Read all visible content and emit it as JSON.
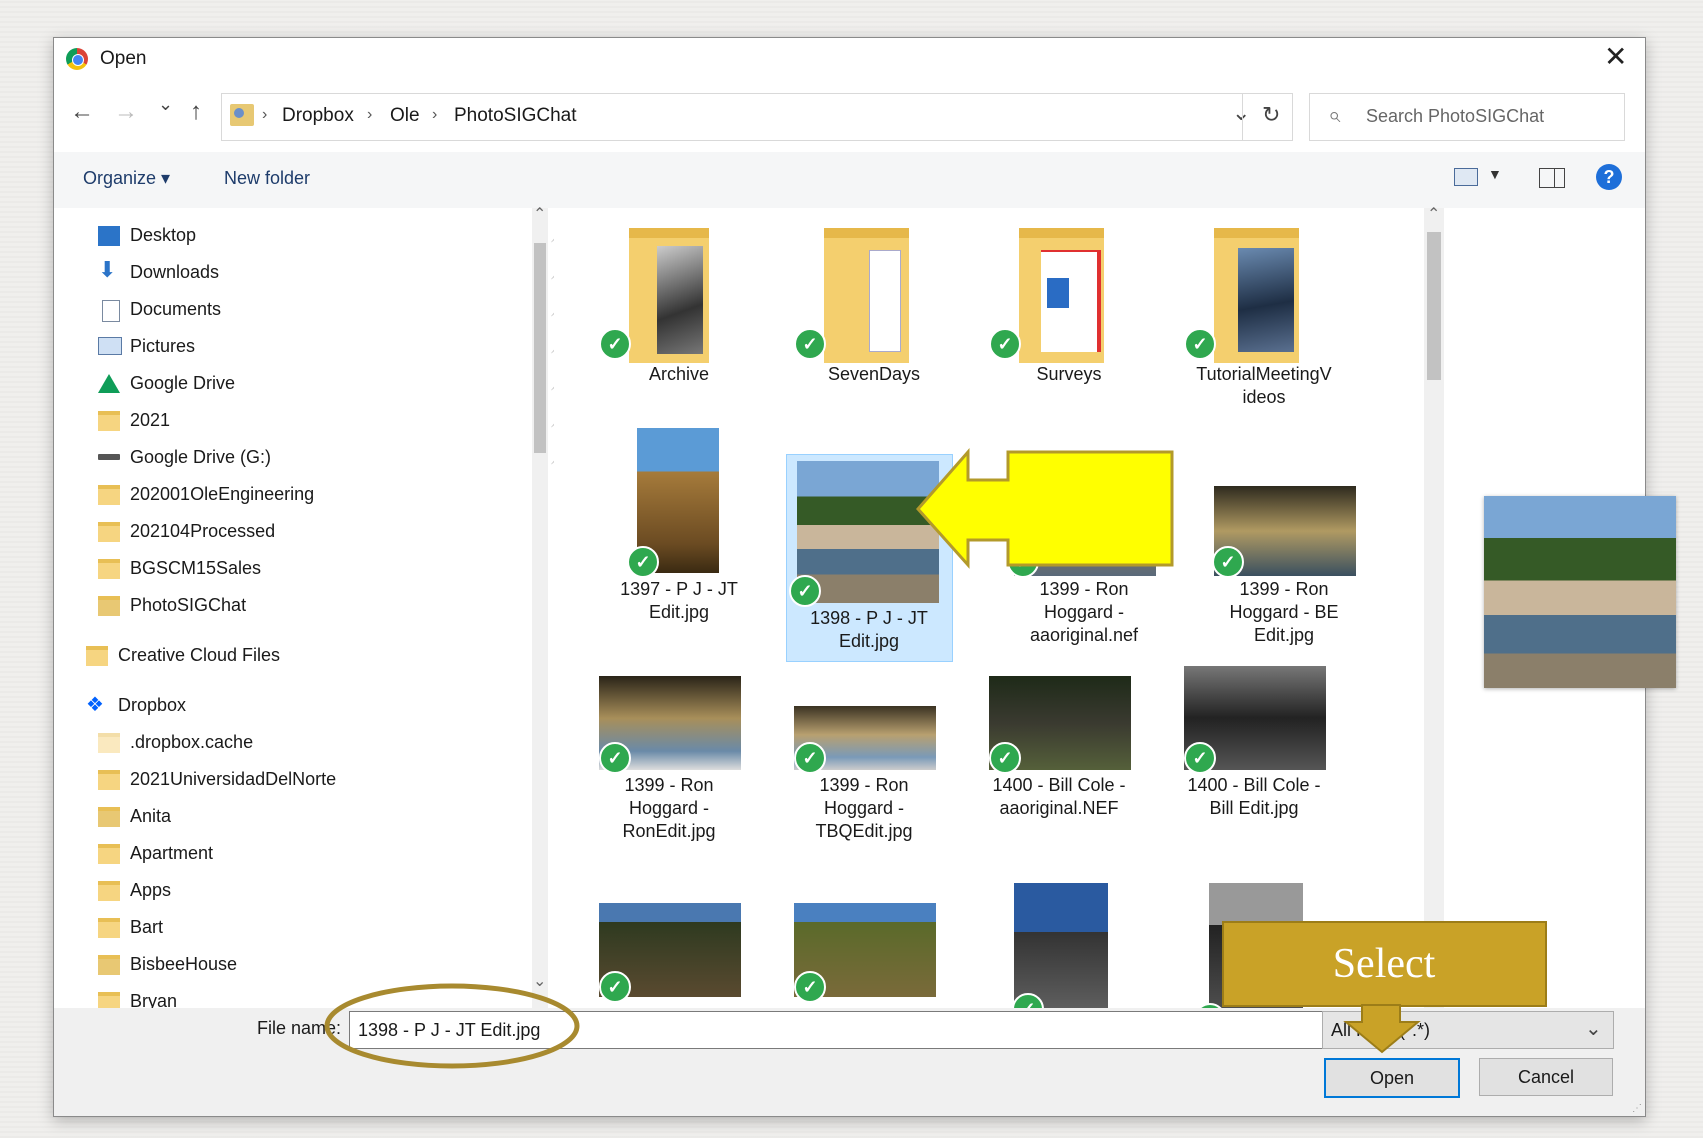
{
  "dialog": {
    "title": "Open",
    "close_glyph": "✕"
  },
  "nav": {
    "back": "←",
    "forward": "→",
    "recent": "⌄",
    "up": "↑",
    "dropdown": "⌄",
    "refresh": "↻"
  },
  "address": {
    "crumbs": [
      "Dropbox",
      "Ole",
      "PhotoSIGChat"
    ],
    "sep": "›"
  },
  "search": {
    "placeholder": "Search PhotoSIGChat",
    "icon": "⌕"
  },
  "toolbar": {
    "organize": "Organize ▾",
    "new_folder": "New folder",
    "help": "?"
  },
  "sidebar": {
    "items": [
      {
        "label": "Desktop"
      },
      {
        "label": "Downloads"
      },
      {
        "label": "Documents"
      },
      {
        "label": "Pictures"
      },
      {
        "label": "Google Drive"
      },
      {
        "label": "2021"
      },
      {
        "label": "Google Drive (G:)"
      },
      {
        "label": "202001OleEngineering"
      },
      {
        "label": "202104Processed"
      },
      {
        "label": "BGSCM15Sales"
      },
      {
        "label": "PhotoSIGChat"
      },
      {
        "label": "Creative Cloud Files"
      },
      {
        "label": "Dropbox"
      },
      {
        "label": ".dropbox.cache"
      },
      {
        "label": "2021UniversidadDelNorte"
      },
      {
        "label": "Anita"
      },
      {
        "label": "Apartment"
      },
      {
        "label": "Apps"
      },
      {
        "label": "Bart"
      },
      {
        "label": "BisbeeHouse"
      },
      {
        "label": "Bryan"
      }
    ],
    "pin_glyph": "📌"
  },
  "files": {
    "row1": [
      "Archive",
      "SevenDays",
      "Surveys",
      "TutorialMeetingV ideos"
    ],
    "row2": [
      "1397 - P J - JT Edit.jpg",
      "1398 - P J - JT Edit.jpg",
      "1399 - Ron Hoggard - aaoriginal.nef",
      "1399 - Ron Hoggard - BE Edit.jpg"
    ],
    "row3": [
      "1399 - Ron Hoggard - RonEdit.jpg",
      "1399 - Ron Hoggard - TBQEdit.jpg",
      "1400 - Bill Cole - aaoriginal.NEF",
      "1400 - Bill Cole - Bill Edit.jpg"
    ],
    "check_glyph": "✓"
  },
  "footer": {
    "file_name_label": "File name:",
    "file_name_value": "1398 - P J - JT Edit.jpg",
    "file_type": "All Files (*.*)",
    "open": "Open",
    "cancel": "Cancel"
  },
  "annotations": {
    "select_label": "Select"
  },
  "colors": {
    "accent": "#0078d7",
    "callout_gold": "#c9a227",
    "arrow_yellow": "#ffff00",
    "ellipse": "#a88a2f"
  }
}
